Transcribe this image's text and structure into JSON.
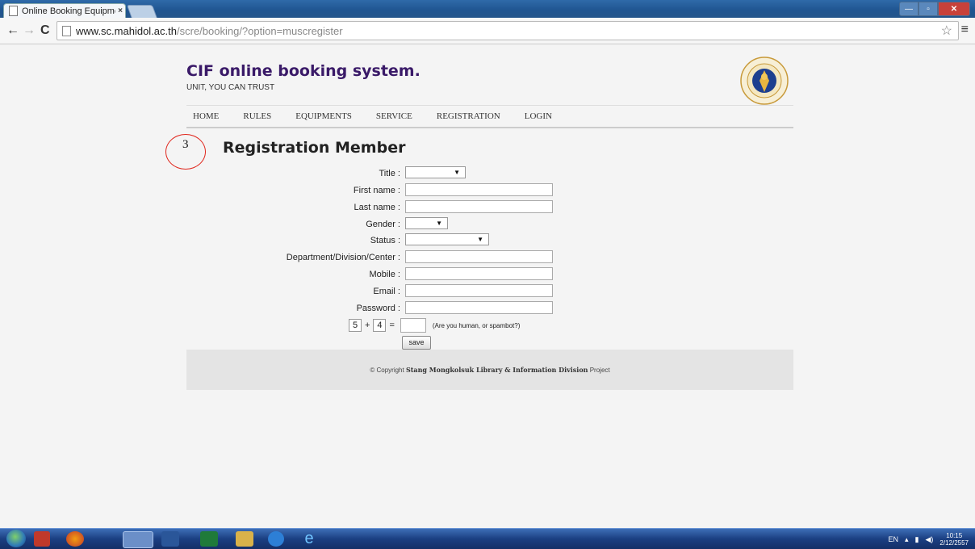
{
  "browser": {
    "tab_title": "Online Booking Equipme",
    "tab_close": "×",
    "url_host": "www.sc.mahidol.ac.th",
    "url_path": "/scre/booking/?option=muscregister"
  },
  "site": {
    "title": "CIF online booking system.",
    "tagline": "UNIT, YOU CAN TRUST",
    "nav": [
      "HOME",
      "RULES",
      "EQUIPMENTS",
      "SERVICE",
      "REGISTRATION",
      "LOGIN"
    ]
  },
  "annotation": {
    "number": "3"
  },
  "form": {
    "heading": "Registration Member",
    "fields": {
      "title": "Title :",
      "first_name": "First name :",
      "last_name": "Last name :",
      "gender": "Gender :",
      "status": "Status :",
      "department": "Department/Division/Center :",
      "mobile": "Mobile :",
      "email": "Email :",
      "password": "Password :"
    },
    "captcha": {
      "a": "5",
      "op": "+",
      "b": "4",
      "eq": "=",
      "hint": "(Are you human, or spambot?)"
    },
    "save_label": "save"
  },
  "footer": {
    "prefix": "© Copyright ",
    "org": "Stang Mongkolsuk Library & Information Division",
    "suffix": " Project"
  },
  "taskbar": {
    "language": "EN",
    "time": "10:15",
    "date": "2/12/2557"
  },
  "colors": {
    "title": "#3a1a68",
    "annotation": "#e0251b",
    "taskbar": "#1b3f82"
  }
}
